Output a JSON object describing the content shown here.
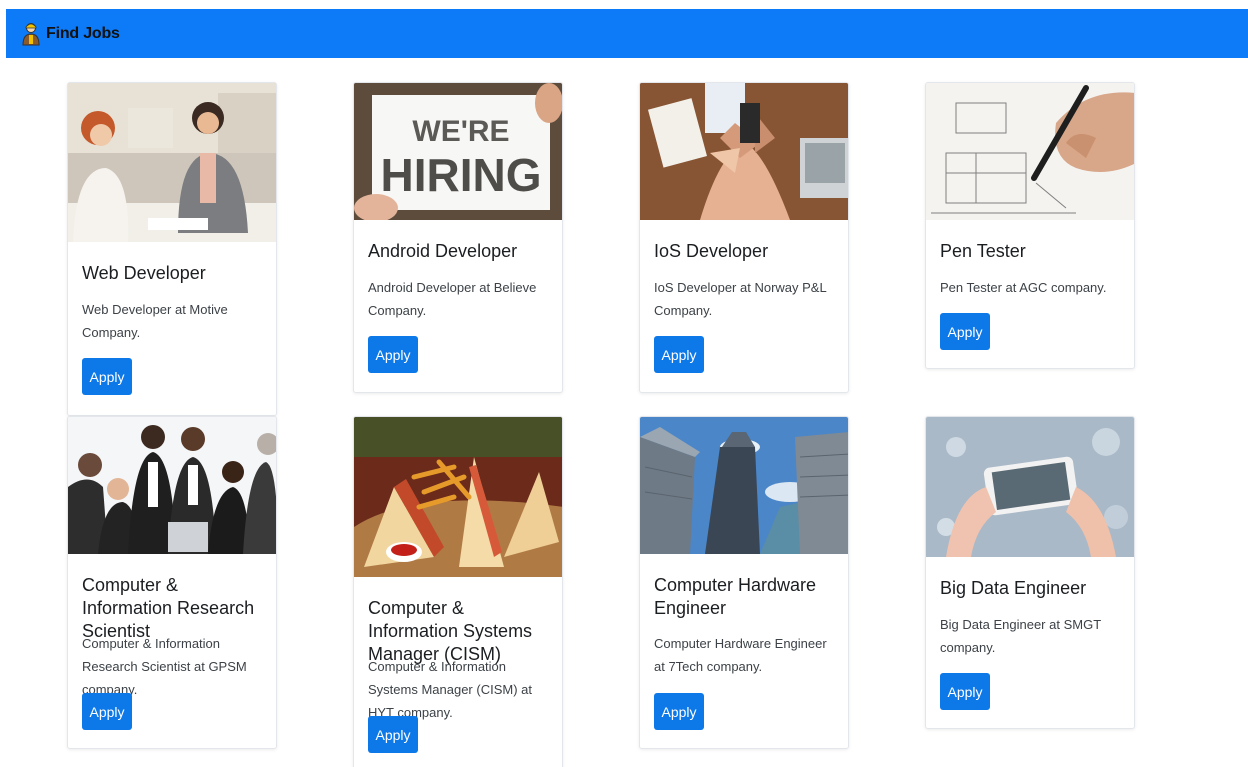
{
  "navbar": {
    "brand": "Find Jobs",
    "brand_icon": "worker-icon"
  },
  "colors": {
    "navbar": "#0d7af7",
    "button": "#0d78e8"
  },
  "jobs": [
    {
      "title": "Web Developer",
      "description": "Web Developer at Motive Company.",
      "apply": "Apply",
      "image": "office-meeting-photo"
    },
    {
      "title": "Android Developer",
      "description": "Android Developer at Believe Company.",
      "apply": "Apply",
      "image": "were-hiring-sign-photo",
      "image_text_1": "WE'RE",
      "image_text_2": "HIRING"
    },
    {
      "title": "IoS Developer",
      "description": "IoS Developer at Norway P&L Company.",
      "apply": "Apply",
      "image": "team-hands-photo"
    },
    {
      "title": "Pen Tester",
      "description": "Pen Tester at AGC company.",
      "apply": "Apply",
      "image": "drawing-hand-photo"
    },
    {
      "title": "Computer & Information Research Scientist",
      "description": "Computer & Information Research Scientist at GPSM company.",
      "apply": "Apply",
      "image": "business-team-photo"
    },
    {
      "title": "Computer & Information Systems Manager (CISM)",
      "description": "Computer & Information Systems Manager (CISM) at HYT company.",
      "apply": "Apply",
      "image": "sandwich-platter-photo"
    },
    {
      "title": "Computer Hardware Engineer",
      "description": "Computer Hardware Engineer at 7Tech company.",
      "apply": "Apply",
      "image": "skyscrapers-photo"
    },
    {
      "title": "Big Data Engineer",
      "description": "Big Data Engineer at SMGT company.",
      "apply": "Apply",
      "image": "phone-city-photo"
    }
  ]
}
